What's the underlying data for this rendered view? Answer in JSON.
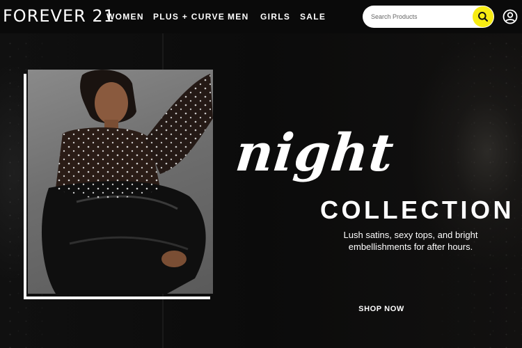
{
  "header": {
    "logo": "FOREVER 21",
    "nav": [
      {
        "label": "WOMEN"
      },
      {
        "label": "PLUS + CURVE"
      },
      {
        "label": "MEN"
      },
      {
        "label": "GIRLS"
      },
      {
        "label": "SALE"
      }
    ],
    "search": {
      "placeholder": "Search Products",
      "value": "",
      "button_icon": "search-icon"
    },
    "account_icon": "user-account-icon"
  },
  "hero": {
    "headline_script": "night",
    "headline": "COLLECTION",
    "subtitle": "Lush satins, sexy tops, and bright embellishments for after hours.",
    "cta": "SHOP NOW",
    "image_alt": "Model wearing sheer pearl-embellished top and black leather pants"
  },
  "colors": {
    "header_bg": "#0a0a0a",
    "hero_bg": "#0c0c0c",
    "search_accent": "#f7ec13",
    "text": "#ffffff"
  }
}
